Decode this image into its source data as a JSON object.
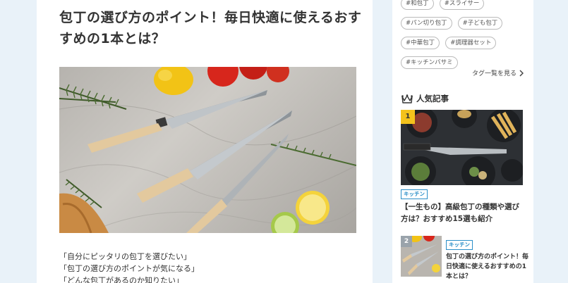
{
  "article": {
    "title": "包丁の選び方のポイント！毎日快適に使えるおすすめの1本とは？",
    "intro": [
      "「自分にピッタリの包丁を選びたい」",
      "「包丁の選び方のポイントが気になる」",
      "「どんな包丁があるのか知りたい」"
    ]
  },
  "sidebar": {
    "tags": [
      "#和包丁",
      "#スライサー",
      "#パン切り包丁",
      "#子ども包丁",
      "#中華包丁",
      "#調理器セット",
      "#キッチンバサミ"
    ],
    "tag_list_link": "タグ一覧を見る",
    "popular": {
      "heading": "人気記事",
      "items": [
        {
          "rank": "1",
          "category": "キッチン",
          "title": "【一生もの】高級包丁の種類や選び方は？おすすめ15選も紹介"
        },
        {
          "rank": "2",
          "category": "キッチン",
          "title": "包丁の選び方のポイント！毎日快適に使えるおすすめの1本とは？"
        }
      ]
    }
  },
  "colors": {
    "page_bg": "#e9f2f9",
    "accent_blue": "#2b8fc8",
    "rank_gold": "#f3c21c"
  }
}
